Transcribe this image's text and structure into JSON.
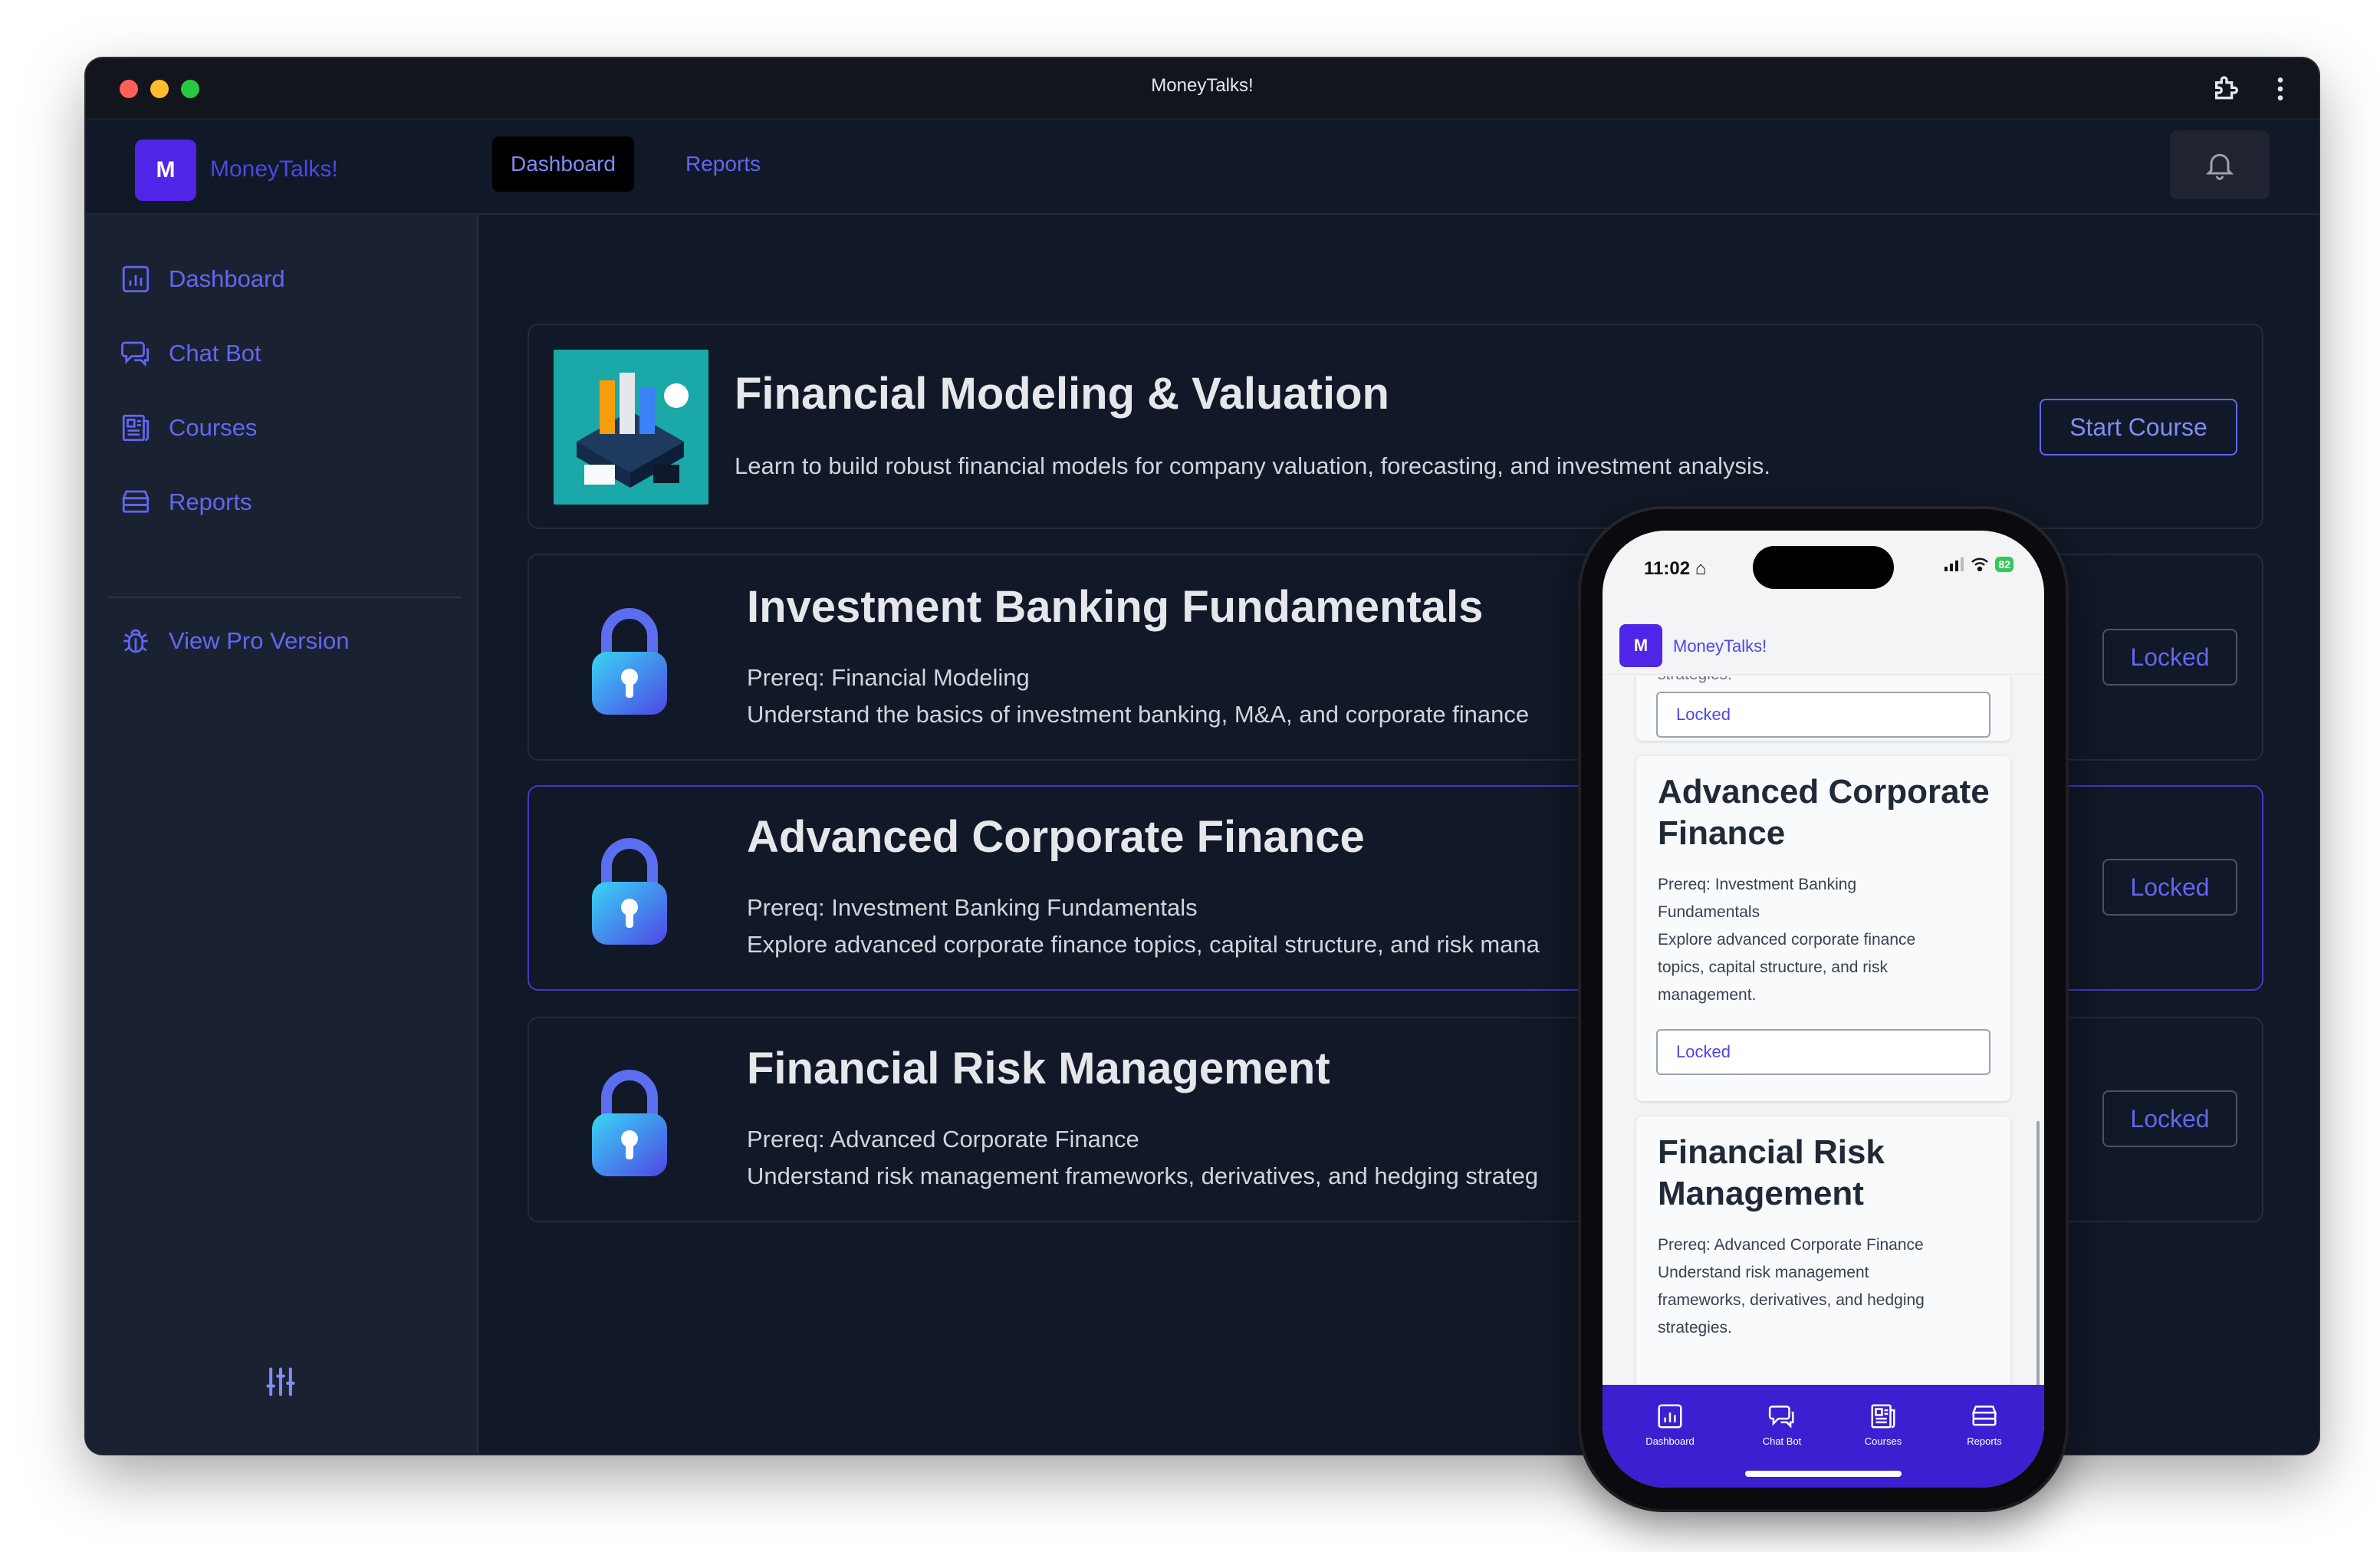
{
  "window": {
    "title": "MoneyTalks!"
  },
  "app": {
    "logo_letter": "M",
    "name": "MoneyTalks!"
  },
  "topnav": {
    "tabs": [
      {
        "label": "Dashboard"
      },
      {
        "label": "Reports"
      }
    ],
    "bell_icon": "bell-icon"
  },
  "sidebar": {
    "items": [
      {
        "label": "Dashboard",
        "icon": "bar-chart-icon"
      },
      {
        "label": "Chat Bot",
        "icon": "chat-bubbles-icon"
      },
      {
        "label": "Courses",
        "icon": "newspaper-icon"
      },
      {
        "label": "Reports",
        "icon": "server-stack-icon"
      }
    ],
    "pro": {
      "label": "View Pro Version",
      "icon": "bug-icon"
    },
    "settings_icon": "sliders-icon"
  },
  "courses": [
    {
      "title": "Financial Modeling & Valuation",
      "description": "Learn to build robust financial models for company valuation, forecasting, and investment analysis.",
      "button": "Start Course"
    },
    {
      "title": "Investment Banking Fundamentals",
      "prereq": "Prereq: Financial Modeling",
      "description": "Understand the basics of investment banking, M&A, and corporate finance",
      "button": "Locked"
    },
    {
      "title": "Advanced Corporate Finance",
      "prereq": "Prereq: Investment Banking Fundamentals",
      "description": "Explore advanced corporate finance topics, capital structure, and risk mana",
      "button": "Locked"
    },
    {
      "title": "Financial Risk Management",
      "prereq": "Prereq: Advanced Corporate Finance",
      "description": "Understand risk management frameworks, derivatives, and hedging strateg",
      "button": "Locked"
    }
  ],
  "phone": {
    "status": {
      "time": "11:02",
      "battery": "82"
    },
    "header": {
      "logo_letter": "M",
      "name": "MoneyTalks!"
    },
    "partial_text": "strategies.",
    "cards": [
      {
        "button": "Locked"
      },
      {
        "title_line1": "Advanced Corporate",
        "title_line2": "Finance",
        "lines": [
          "Prereq: Investment Banking",
          "Fundamentals",
          "Explore advanced corporate finance",
          "topics, capital structure, and risk",
          "management."
        ],
        "button": "Locked"
      },
      {
        "title_line1": "Financial Risk",
        "title_line2": "Management",
        "lines": [
          "Prereq: Advanced Corporate Finance",
          "Understand risk management",
          "frameworks, derivatives, and hedging",
          "strategies."
        ]
      }
    ],
    "tabbar": [
      {
        "label": "Dashboard",
        "icon": "bar-chart-icon"
      },
      {
        "label": "Chat Bot",
        "icon": "chat-bubbles-icon"
      },
      {
        "label": "Courses",
        "icon": "newspaper-icon"
      },
      {
        "label": "Reports",
        "icon": "server-stack-icon"
      }
    ]
  }
}
